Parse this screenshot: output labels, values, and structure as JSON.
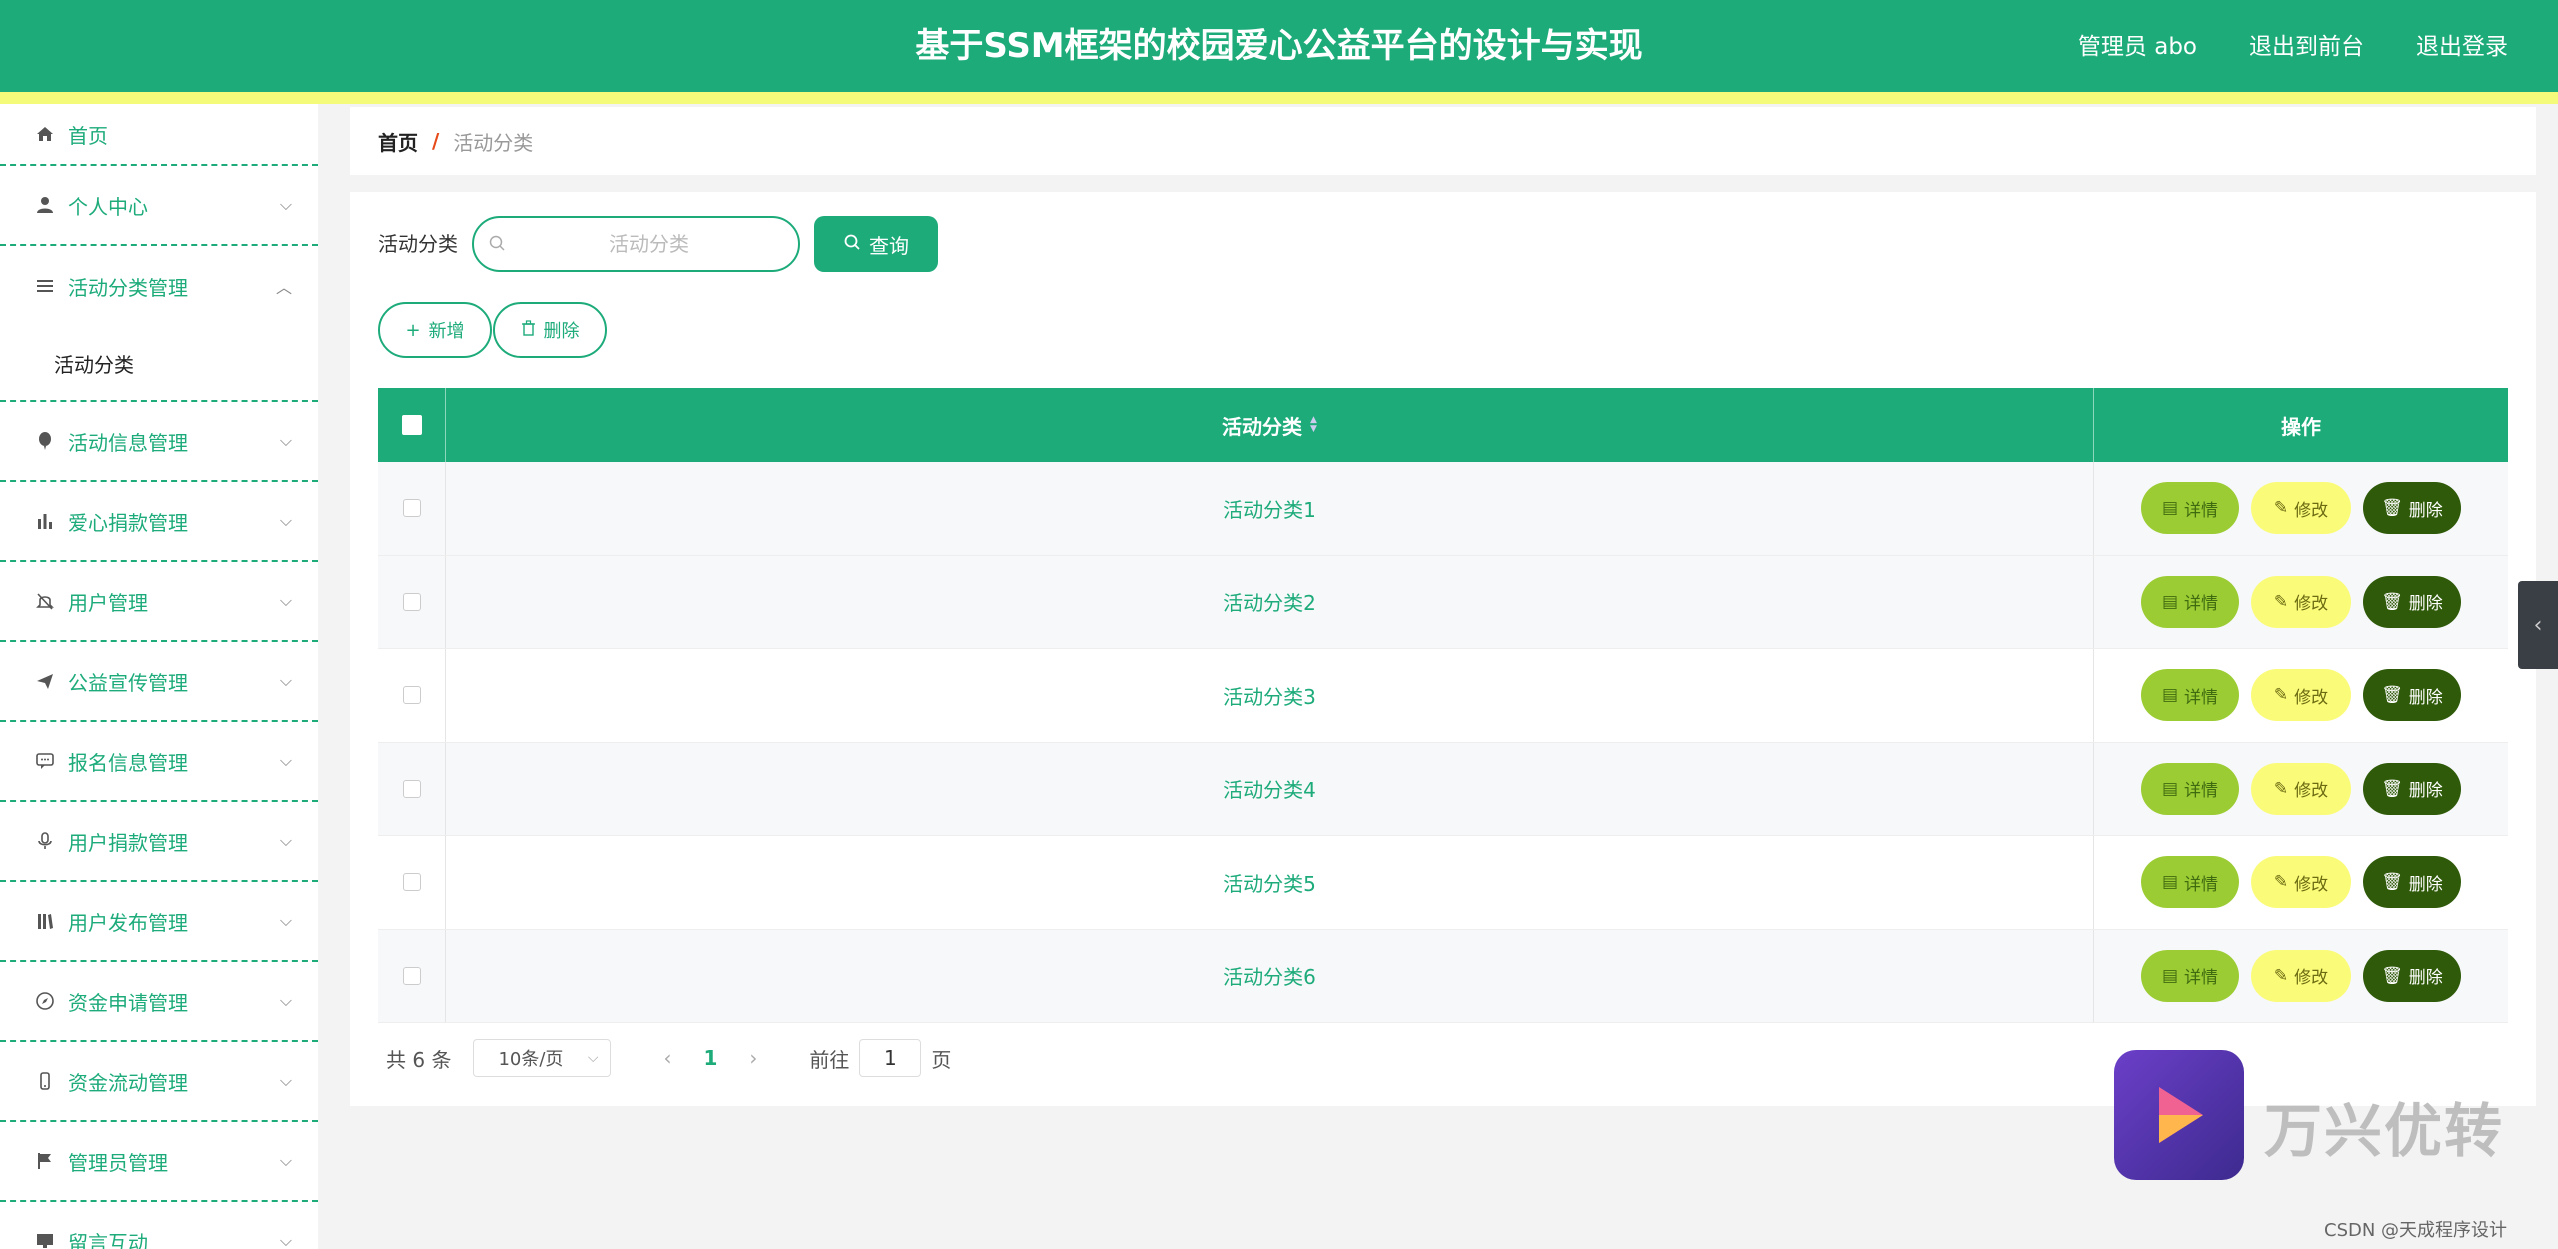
{
  "header": {
    "title": "基于SSM框架的校园爱心公益平台的设计与实现",
    "admin": "管理员 abo",
    "to_front": "退出到前台",
    "logout": "退出登录"
  },
  "sidebar": {
    "items": [
      {
        "label": "首页",
        "icon": "home-icon"
      },
      {
        "label": "个人中心",
        "icon": "user-icon"
      },
      {
        "label": "活动分类管理",
        "icon": "list-icon"
      },
      {
        "label": "活动信息管理",
        "icon": "balloon-icon"
      },
      {
        "label": "爱心捐款管理",
        "icon": "bar-chart-icon"
      },
      {
        "label": "用户管理",
        "icon": "bell-off-icon"
      },
      {
        "label": "公益宣传管理",
        "icon": "send-icon"
      },
      {
        "label": "报名信息管理",
        "icon": "chat-icon"
      },
      {
        "label": "用户捐款管理",
        "icon": "microphone-icon"
      },
      {
        "label": "用户发布管理",
        "icon": "library-icon"
      },
      {
        "label": "资金申请管理",
        "icon": "compass-icon"
      },
      {
        "label": "资金流动管理",
        "icon": "phone-icon"
      },
      {
        "label": "管理员管理",
        "icon": "flag-icon"
      },
      {
        "label": "留言互动",
        "icon": "monitor-icon"
      }
    ],
    "submenu_label": "活动分类"
  },
  "breadcrumb": {
    "home": "首页",
    "separator": "/",
    "current": "活动分类"
  },
  "search": {
    "label": "活动分类",
    "placeholder": "活动分类",
    "query_button": "查询"
  },
  "actions": {
    "add": "新增",
    "delete": "删除"
  },
  "table": {
    "headers": {
      "name": "活动分类",
      "ops": "操作"
    },
    "rows": [
      "活动分类1",
      "活动分类2",
      "活动分类3",
      "活动分类4",
      "活动分类5",
      "活动分类6"
    ],
    "op_labels": {
      "detail": "详情",
      "edit": "修改",
      "delete": "删除"
    }
  },
  "pagination": {
    "total": "共 6 条",
    "page_size": "10条/页",
    "current_page": "1",
    "goto_prefix": "前往",
    "goto_value": "1",
    "goto_suffix": "页"
  },
  "watermark": {
    "brand": "万兴优转",
    "credit": "CSDN @天成程序设计"
  },
  "colors": {
    "primary": "#1dab7a",
    "stripe": "#f4fa7a",
    "detail": "#9ccc34",
    "edit": "#fbfb7a",
    "delete": "#2f5a0a"
  }
}
